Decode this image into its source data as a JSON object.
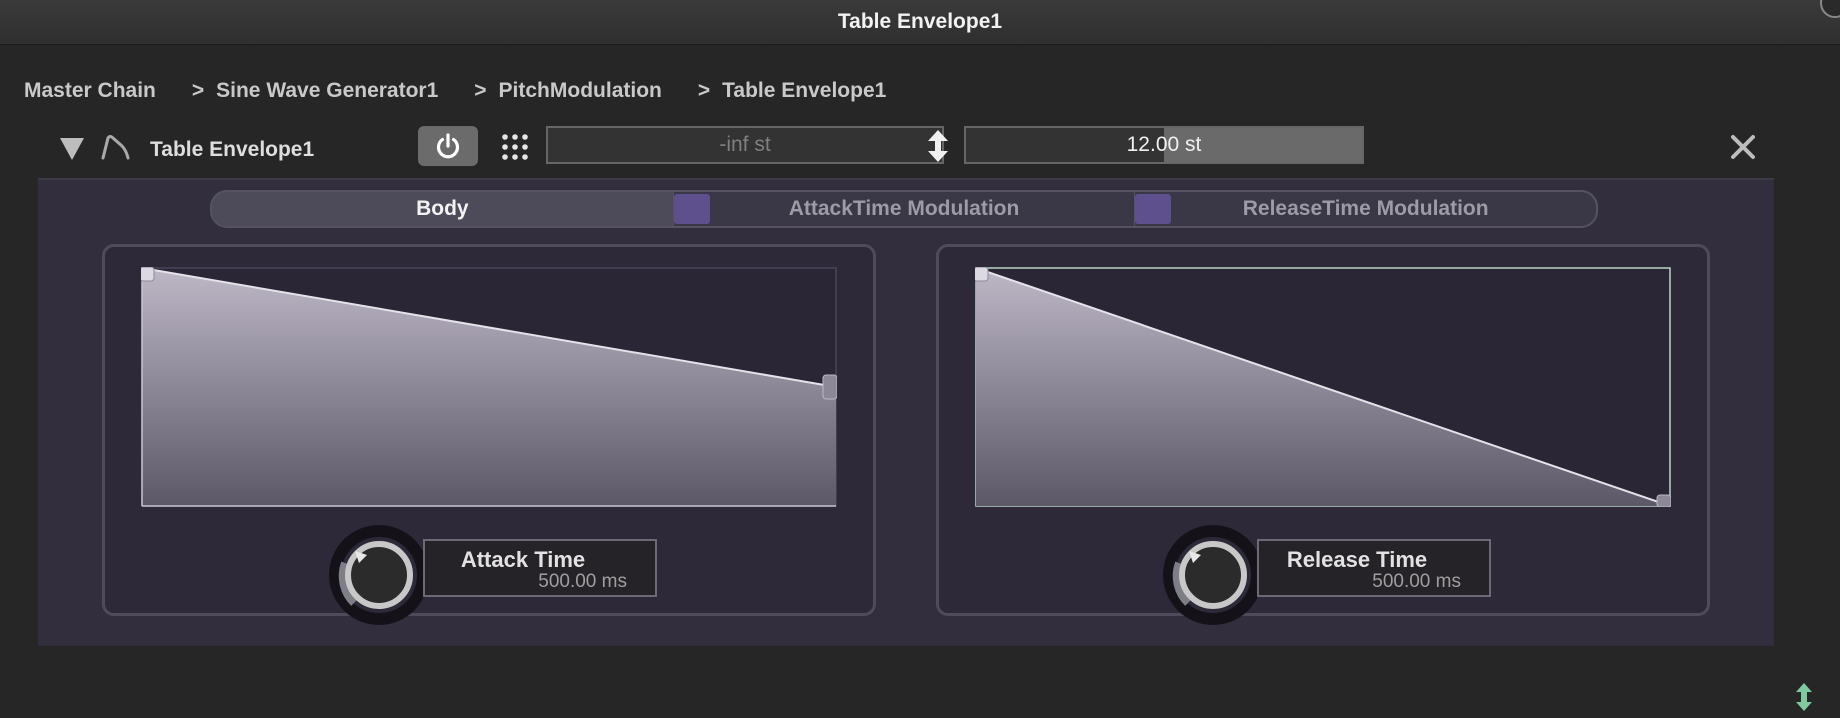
{
  "window": {
    "title": "Table Envelope1"
  },
  "breadcrumb": [
    "Master Chain",
    "Sine Wave Generator1",
    "PitchModulation",
    "Table Envelope1"
  ],
  "breadcrumb_separator": ">",
  "module": {
    "title": "Table Envelope1",
    "min_value": "-inf st",
    "max_value": "12.00 st",
    "max_fill_fraction": 0.5,
    "power_on": true
  },
  "tabs": [
    {
      "label": "Body",
      "selected": true
    },
    {
      "label": "AttackTime Modulation",
      "selected": false
    },
    {
      "label": "ReleaseTime Modulation",
      "selected": false
    }
  ],
  "attack": {
    "label": "Attack Time",
    "value": "500.00 ms",
    "table_start": 1.0,
    "table_end": 0.5
  },
  "release": {
    "label": "Release Time",
    "value": "500.00 ms",
    "table_start": 1.0,
    "table_end": 0.0
  },
  "colors": {
    "panel": "#322e3e",
    "accent_purple": "#5e4f8d",
    "table_fill_top": "#bdb7c6",
    "table_fill_bottom": "#5c5868"
  }
}
